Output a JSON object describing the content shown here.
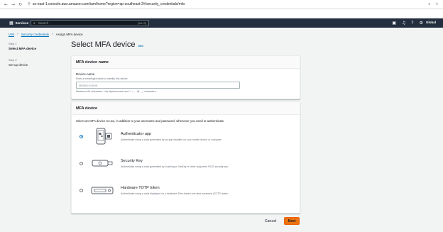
{
  "browser": {
    "url": "us-east-1.console.aws.amazon.com/iam/home?region=ap-southeast-2#/security_credentials/mfa"
  },
  "aws_nav": {
    "services_label": "Services",
    "search_placeholder": "Search",
    "search_shortcut": "[Alt+S]",
    "region_label": "Global"
  },
  "breadcrumb": {
    "items": [
      "IAM",
      "Security credentials",
      "Assign MFA device"
    ]
  },
  "steps": [
    {
      "num": "Step 1",
      "name": "Select MFA device"
    },
    {
      "num": "Step 2",
      "name": "Set up device"
    }
  ],
  "page": {
    "title": "Select MFA device",
    "info_label": "Info"
  },
  "device_name_panel": {
    "header": "MFA device name",
    "field_label": "Device name",
    "field_description": "Enter a meaningful name to identify this device.",
    "placeholder": "Device name",
    "constraint": "Maximum 64 characters. Use alphanumeric and '+ = , . @ - _' characters."
  },
  "mfa_panel": {
    "header": "MFA device",
    "intro": "Select an MFA device to use, in addition to your username and password, whenever you need to authenticate.",
    "options": [
      {
        "title": "Authenticator app",
        "description": "Authenticate using a code generated by an app installed on your mobile device or computer.",
        "selected": true
      },
      {
        "title": "Security Key",
        "description": "Authenticate using a code generated by touching a YubiKey or other supported FIDO security key.",
        "selected": false
      },
      {
        "title": "Hardware TOTP token",
        "description": "Authenticate using a code displayed on a hardware Time-based one-time password (TOTP) token.",
        "selected": false
      }
    ]
  },
  "footer": {
    "cancel_label": "Cancel",
    "next_label": "Next"
  },
  "colors": {
    "aws_nav_bg": "#232f3e",
    "link": "#0073bb",
    "primary_button": "#ec7211"
  }
}
